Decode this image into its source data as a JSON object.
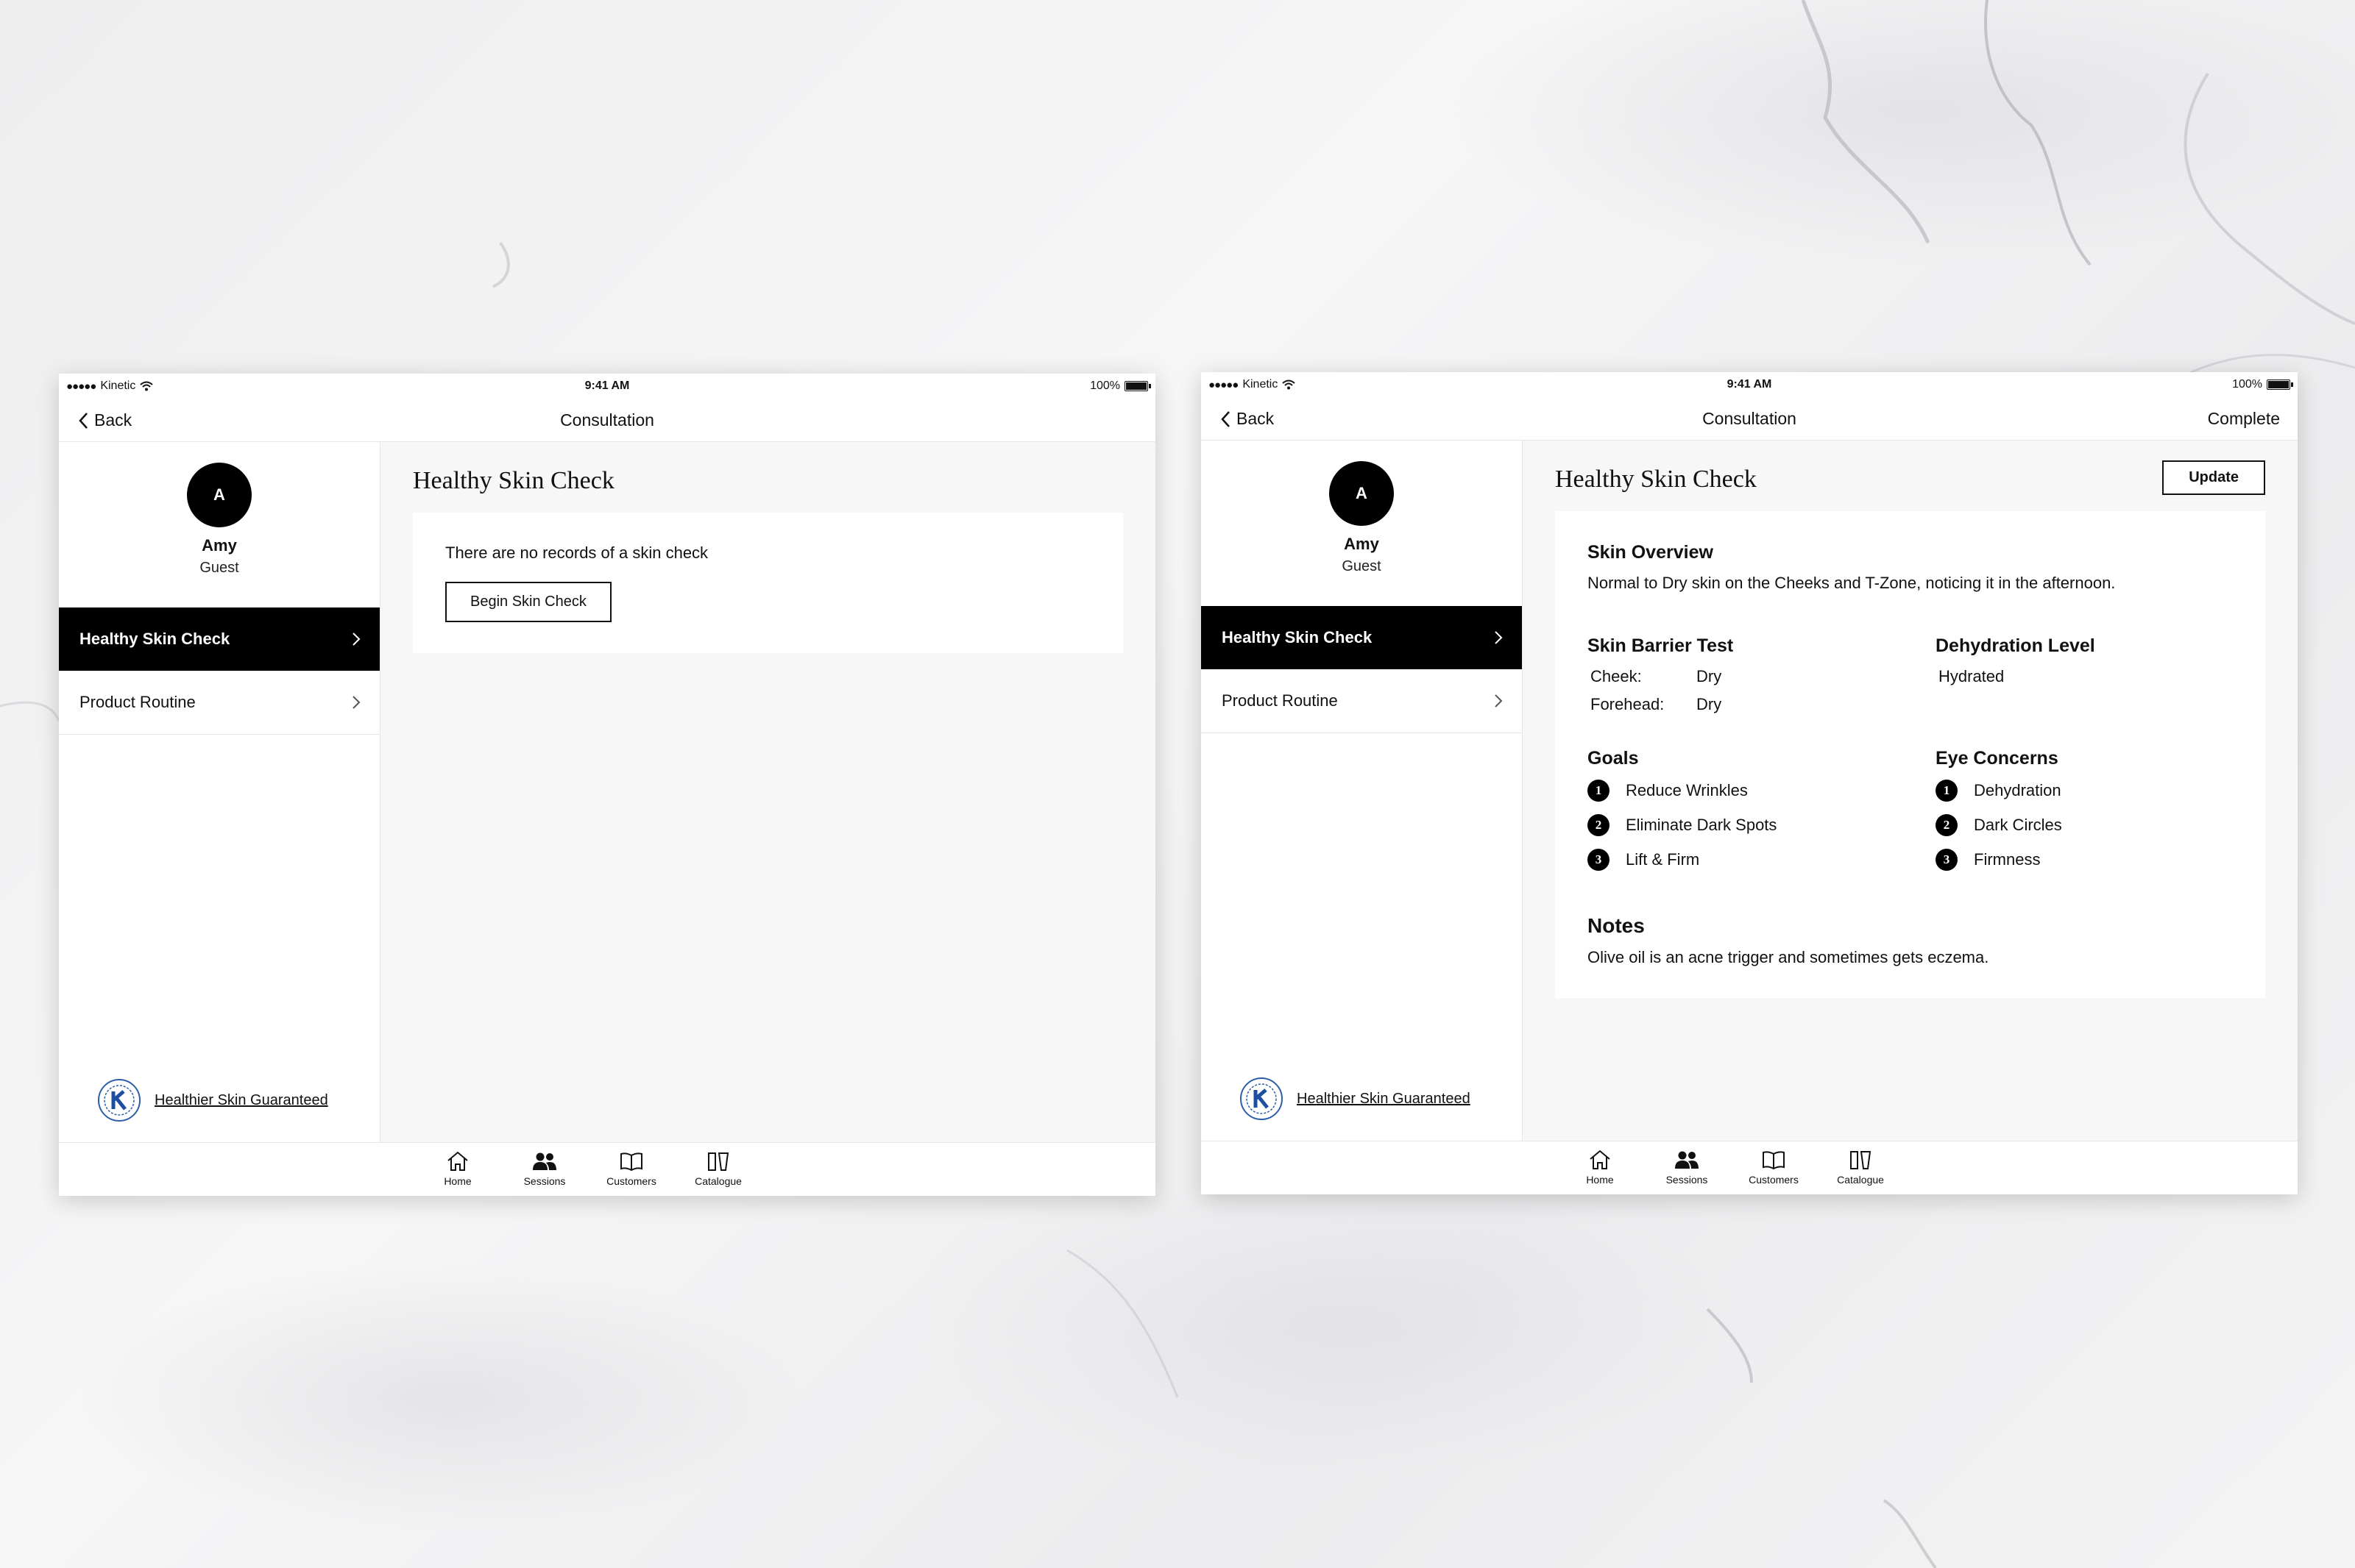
{
  "screens": [
    {
      "status": {
        "carrier_dots": "●●●●●",
        "carrier": "Kinetic",
        "time": "9:41 AM",
        "battery": "100%"
      },
      "nav": {
        "back": "Back",
        "title": "Consultation",
        "right": ""
      },
      "profile": {
        "initial": "A",
        "name": "Amy",
        "role": "Guest"
      },
      "menu": [
        {
          "label": "Healthy Skin Check",
          "active": true
        },
        {
          "label": "Product Routine",
          "active": false
        }
      ],
      "guarantee": "Healthier Skin Guaranteed",
      "main": {
        "title": "Healthy Skin Check",
        "empty_text": "There are no records of a skin check",
        "begin_button": "Begin Skin Check"
      },
      "tabs": [
        {
          "label": "Home",
          "icon": "home-icon"
        },
        {
          "label": "Sessions",
          "icon": "sessions-icon"
        },
        {
          "label": "Customers",
          "icon": "book-icon"
        },
        {
          "label": "Catalogue",
          "icon": "catalogue-icon"
        }
      ]
    },
    {
      "status": {
        "carrier_dots": "●●●●●",
        "carrier": "Kinetic",
        "time": "9:41 AM",
        "battery": "100%"
      },
      "nav": {
        "back": "Back",
        "title": "Consultation",
        "right": "Complete"
      },
      "profile": {
        "initial": "A",
        "name": "Amy",
        "role": "Guest"
      },
      "menu": [
        {
          "label": "Healthy Skin Check",
          "active": true
        },
        {
          "label": "Product Routine",
          "active": false
        }
      ],
      "guarantee": "Healthier Skin Guaranteed",
      "main": {
        "title": "Healthy Skin Check",
        "update_button": "Update",
        "overview": {
          "title": "Skin Overview",
          "text": "Normal to Dry skin on the Cheeks and T-Zone, noticing it in the afternoon."
        },
        "barrier": {
          "title": "Skin Barrier Test",
          "rows": [
            {
              "label": "Cheek:",
              "value": "Dry"
            },
            {
              "label": "Forehead:",
              "value": "Dry"
            }
          ]
        },
        "dehydration": {
          "title": "Dehydration Level",
          "value": "Hydrated"
        },
        "goals": {
          "title": "Goals",
          "items": [
            "Reduce Wrinkles",
            "Eliminate Dark Spots",
            "Lift & Firm"
          ]
        },
        "eye": {
          "title": "Eye Concerns",
          "items": [
            "Dehydration",
            "Dark Circles",
            "Firmness"
          ]
        },
        "numbers": [
          "1",
          "2",
          "3"
        ],
        "notes": {
          "title": "Notes",
          "text": "Olive oil is an acne trigger and sometimes gets eczema."
        }
      },
      "tabs": [
        {
          "label": "Home",
          "icon": "home-icon"
        },
        {
          "label": "Sessions",
          "icon": "sessions-icon"
        },
        {
          "label": "Customers",
          "icon": "book-icon"
        },
        {
          "label": "Catalogue",
          "icon": "catalogue-icon"
        }
      ]
    }
  ]
}
